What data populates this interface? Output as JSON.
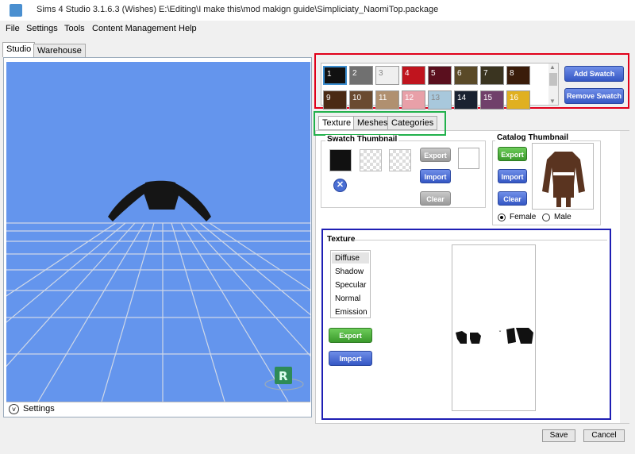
{
  "window": {
    "title": "Sims 4 Studio 3.1.6.3 (Wishes)  E:\\Editing\\I make this\\mod makign guide\\Simpliciaty_NaomiTop.package"
  },
  "menu": [
    "File",
    "Settings",
    "Tools",
    "Content Management",
    "Help"
  ],
  "left_tabs": [
    "Studio",
    "Warehouse"
  ],
  "settings_label": "Settings",
  "swatches": [
    {
      "n": "1",
      "color": "#111111"
    },
    {
      "n": "2",
      "color": "#707070"
    },
    {
      "n": "3",
      "color": "#efefef"
    },
    {
      "n": "4",
      "color": "#c0141e"
    },
    {
      "n": "5",
      "color": "#5a0f1e"
    },
    {
      "n": "6",
      "color": "#5a4a28"
    },
    {
      "n": "7",
      "color": "#3a3420"
    },
    {
      "n": "8",
      "color": "#3a1c0a"
    },
    {
      "n": "9",
      "color": "#4a2a14"
    },
    {
      "n": "10",
      "color": "#6a4a30"
    },
    {
      "n": "11",
      "color": "#b09070"
    },
    {
      "n": "12",
      "color": "#e8a0a8"
    },
    {
      "n": "13",
      "color": "#a8c8dc"
    },
    {
      "n": "14",
      "color": "#1a2230"
    },
    {
      "n": "15",
      "color": "#70406a"
    },
    {
      "n": "16",
      "color": "#e0b020"
    }
  ],
  "swatch_buttons": {
    "add": "Add Swatch",
    "remove": "Remove Swatch"
  },
  "sub_tabs": [
    "Texture",
    "Meshes",
    "Categories"
  ],
  "swatch_thumbnail": {
    "label": "Swatch Thumbnail",
    "export": "Export",
    "import": "Import",
    "clear": "Clear"
  },
  "catalog_thumbnail": {
    "label": "Catalog Thumbnail",
    "export": "Export",
    "import": "Import",
    "clear": "Clear",
    "female": "Female",
    "male": "Male",
    "selected": "Female"
  },
  "texture": {
    "label": "Texture",
    "items": [
      "Diffuse",
      "Shadow",
      "Specular",
      "Normal",
      "Emission"
    ],
    "selected": "Diffuse",
    "export": "Export",
    "import": "Import"
  },
  "bottom": {
    "save": "Save",
    "cancel": "Cancel"
  },
  "colors": {
    "viewport": "#6495ed",
    "annotation_red": "#e0001a",
    "annotation_green": "#22b14c",
    "annotation_blue": "#1f1fb4"
  }
}
